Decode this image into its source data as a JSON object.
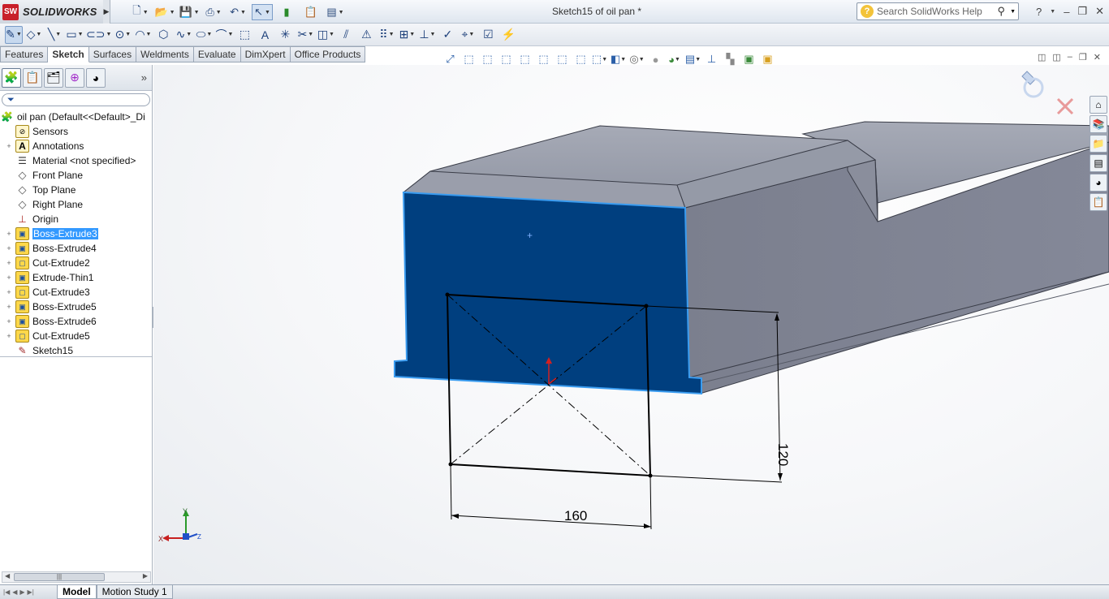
{
  "app": {
    "brand": "SOLIDWORKS",
    "logo_mark": "SW",
    "document_title": "Sketch15 of oil pan *"
  },
  "search": {
    "placeholder": "Search SolidWorks Help"
  },
  "command_tabs": [
    "Features",
    "Sketch",
    "Surfaces",
    "Weldments",
    "Evaluate",
    "DimXpert",
    "Office Products"
  ],
  "active_command_tab": "Sketch",
  "feature_tree": {
    "root": "oil pan  (Default<<Default>_Di",
    "items": [
      {
        "label": "Sensors",
        "icon": "sensor-icon",
        "expandable": false
      },
      {
        "label": "Annotations",
        "icon": "annotations-icon",
        "expandable": true
      },
      {
        "label": "Material <not specified>",
        "icon": "material-icon",
        "expandable": false
      },
      {
        "label": "Front Plane",
        "icon": "plane-icon",
        "expandable": false
      },
      {
        "label": "Top Plane",
        "icon": "plane-icon",
        "expandable": false
      },
      {
        "label": "Right Plane",
        "icon": "plane-icon",
        "expandable": false
      },
      {
        "label": "Origin",
        "icon": "origin-icon",
        "expandable": false
      },
      {
        "label": "Boss-Extrude3",
        "icon": "boss-extrude-icon",
        "expandable": true,
        "selected": true
      },
      {
        "label": "Boss-Extrude4",
        "icon": "boss-extrude-icon",
        "expandable": true
      },
      {
        "label": "Cut-Extrude2",
        "icon": "cut-extrude-icon",
        "expandable": true
      },
      {
        "label": "Extrude-Thin1",
        "icon": "extrude-thin-icon",
        "expandable": true
      },
      {
        "label": "Cut-Extrude3",
        "icon": "cut-extrude-icon",
        "expandable": true
      },
      {
        "label": "Boss-Extrude5",
        "icon": "boss-extrude-icon",
        "expandable": true
      },
      {
        "label": "Boss-Extrude6",
        "icon": "boss-extrude-icon",
        "expandable": true
      },
      {
        "label": "Cut-Extrude5",
        "icon": "cut-extrude-icon",
        "expandable": true
      },
      {
        "label": "Sketch15",
        "icon": "sketch-icon",
        "expandable": false
      }
    ]
  },
  "dimensions": {
    "width": "160",
    "height": "120"
  },
  "triad": {
    "x": "X",
    "y": "Y",
    "z": "Z"
  },
  "bottom_tabs": [
    "Model",
    "Motion Study 1"
  ],
  "active_bottom_tab": "Model",
  "colors": {
    "selected_face": "#003f7f",
    "body": "#7f8393",
    "highlight_edge": "#3a9cf0",
    "tree_selection": "#3399ff"
  }
}
